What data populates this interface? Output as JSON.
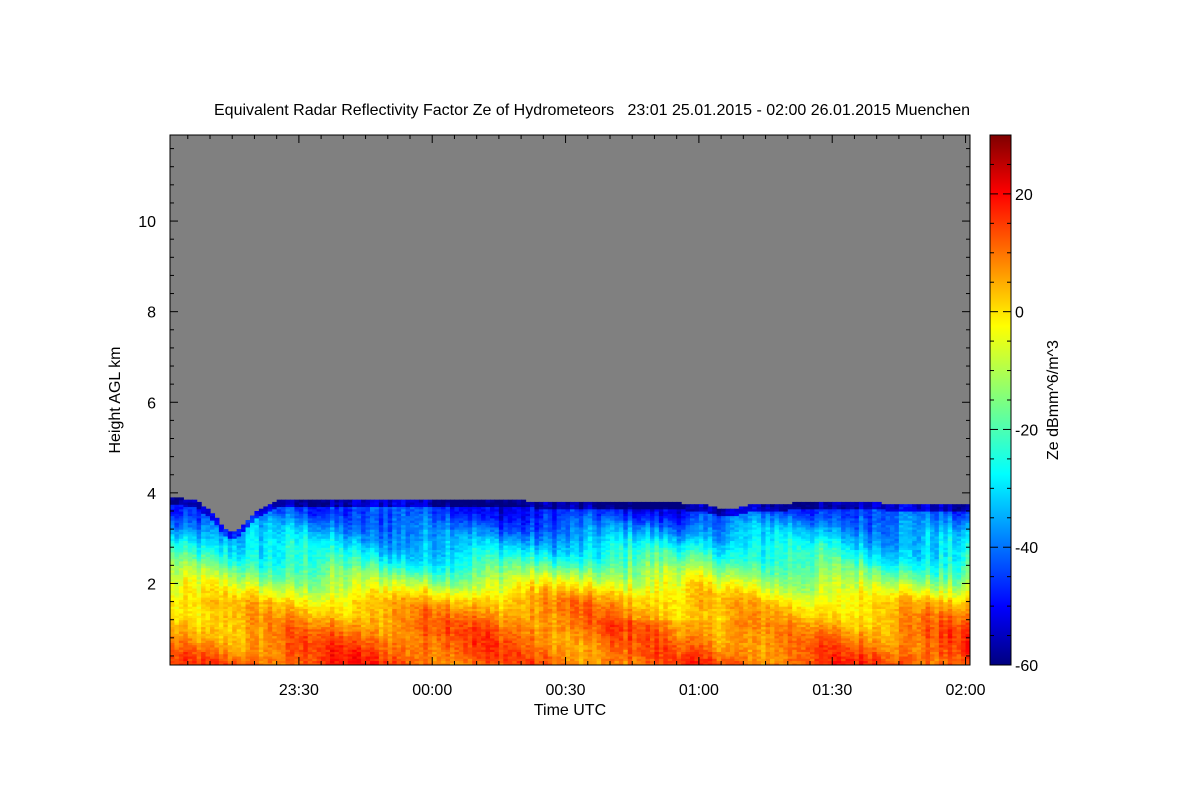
{
  "chart_data": {
    "type": "heatmap",
    "title": "Equivalent Radar Reflectivity Factor Ze of Hydrometeors   23:01 25.01.2015 - 02:00 26.01.2015 Muenchen",
    "xlabel": "Time UTC",
    "ylabel": "Height AGL km",
    "colorbar_label": "Ze dBmm^6/m^3",
    "x_ticks": [
      "23:30",
      "00:00",
      "00:30",
      "01:00",
      "01:30",
      "02:00"
    ],
    "x_tick_minutes": [
      29,
      59,
      89,
      119,
      149,
      179
    ],
    "xlim_minutes": [
      0,
      180
    ],
    "time_start": "23:01 25.01.2015",
    "time_end": "02:00 26.01.2015",
    "y_ticks": [
      2,
      4,
      6,
      8,
      10
    ],
    "ylim": [
      0.2,
      11.9
    ],
    "colorbar_ticks": [
      20,
      0,
      -20,
      -40,
      -60
    ],
    "colorbar_range": [
      -60,
      30
    ],
    "colormap": "jet",
    "no_signal_color": "#808080",
    "echo_top_km": [
      [
        0,
        3.9
      ],
      [
        6,
        3.8
      ],
      [
        10,
        3.5
      ],
      [
        12,
        3.2
      ],
      [
        14,
        3.1
      ],
      [
        16,
        3.2
      ],
      [
        18,
        3.4
      ],
      [
        20,
        3.6
      ],
      [
        22,
        3.7
      ],
      [
        24,
        3.8
      ],
      [
        40,
        3.8
      ],
      [
        60,
        3.8
      ],
      [
        80,
        3.8
      ],
      [
        100,
        3.75
      ],
      [
        115,
        3.75
      ],
      [
        121,
        3.7
      ],
      [
        124,
        3.6
      ],
      [
        127,
        3.6
      ],
      [
        130,
        3.7
      ],
      [
        140,
        3.75
      ],
      [
        160,
        3.75
      ],
      [
        170,
        3.7
      ],
      [
        178,
        3.7
      ],
      [
        180,
        3.7
      ]
    ],
    "reflectivity_profile": [
      {
        "height_km": 0.3,
        "ze_dbz": 10
      },
      {
        "height_km": 1.0,
        "ze_dbz": 7
      },
      {
        "height_km": 1.6,
        "ze_dbz": 2
      },
      {
        "height_km": 2.0,
        "ze_dbz": -8
      },
      {
        "height_km": 2.5,
        "ze_dbz": -22
      },
      {
        "height_km": 3.0,
        "ze_dbz": -32
      },
      {
        "height_km": 3.6,
        "ze_dbz": -45
      }
    ]
  }
}
